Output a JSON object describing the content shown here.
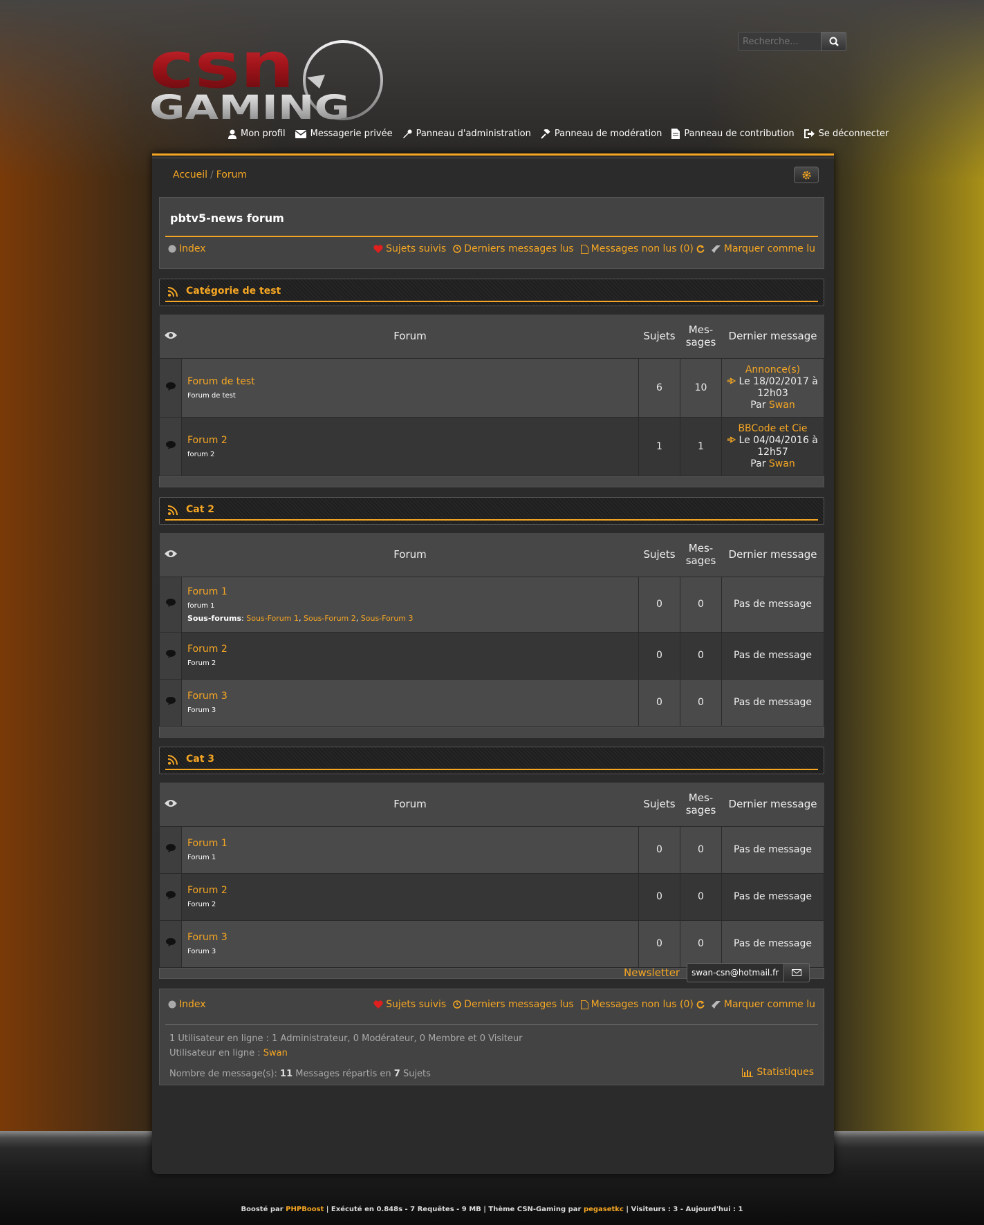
{
  "header": {
    "logo_text_top": "CSN",
    "logo_text_bottom": "GAMING",
    "search_placeholder": "Recherche...",
    "nav": [
      {
        "label": "Mon profil",
        "icon": "user-icon"
      },
      {
        "label": "Messagerie privée",
        "icon": "envelope-icon"
      },
      {
        "label": "Panneau d'administration",
        "icon": "wrench-icon"
      },
      {
        "label": "Panneau de modération",
        "icon": "gavel-icon"
      },
      {
        "label": "Panneau de contribution",
        "icon": "file-icon"
      },
      {
        "label": "Se déconnecter",
        "icon": "sign-out-icon"
      }
    ]
  },
  "breadcrumb": {
    "home": "Accueil",
    "current": "Forum"
  },
  "forum": {
    "title": "pbtv5-news forum",
    "index_label": "Index",
    "links": {
      "followed": "Sujets suivis",
      "last_read": "Derniers messages lus",
      "unread": "Messages non lus (0)",
      "mark_read": "Marquer comme lu"
    }
  },
  "table_headers": {
    "forum": "Forum",
    "topics": "Sujets",
    "messages_line1": "Mes-",
    "messages_line2": "sages",
    "last": "Dernier message"
  },
  "categories": [
    {
      "name": "Catégorie de test",
      "forums": [
        {
          "name": "Forum de test",
          "desc": "Forum de test",
          "topics": "6",
          "messages": "10",
          "last_topic": "Annonce(s)",
          "last_date_line1": "Le 18/02/2017 à",
          "last_date_line2": "12h03",
          "last_by": "Par",
          "last_user": "Swan"
        },
        {
          "name": "Forum 2",
          "desc": "forum 2",
          "topics": "1",
          "messages": "1",
          "last_topic": "BBCode et Cie",
          "last_date_line1": "Le 04/04/2016 à",
          "last_date_line2": "12h57",
          "last_by": "Par",
          "last_user": "Swan"
        }
      ]
    },
    {
      "name": "Cat 2",
      "forums": [
        {
          "name": "Forum 1",
          "desc": "forum 1",
          "topics": "0",
          "messages": "0",
          "no_msg": "Pas de message",
          "subforums_label": "Sous-forums",
          "subforums": [
            "Sous-Forum 1",
            "Sous-Forum 2",
            "Sous-Forum 3"
          ]
        },
        {
          "name": "Forum 2",
          "desc": "Forum 2",
          "topics": "0",
          "messages": "0",
          "no_msg": "Pas de message"
        },
        {
          "name": "Forum 3",
          "desc": "Forum 3",
          "topics": "0",
          "messages": "0",
          "no_msg": "Pas de message"
        }
      ]
    },
    {
      "name": "Cat 3",
      "forums": [
        {
          "name": "Forum 1",
          "desc": "Forum 1",
          "topics": "0",
          "messages": "0",
          "no_msg": "Pas de message"
        },
        {
          "name": "Forum 2",
          "desc": "Forum 2",
          "topics": "0",
          "messages": "0",
          "no_msg": "Pas de message"
        },
        {
          "name": "Forum 3",
          "desc": "Forum 3",
          "topics": "0",
          "messages": "0",
          "no_msg": "Pas de message"
        }
      ]
    }
  ],
  "footer_box": {
    "online_line": "1 Utilisateur en ligne : 1 Administrateur, 0 Modérateur, 0 Membre et 0 Visiteur",
    "online_users_label": "Utilisateur en ligne :",
    "online_user": "Swan",
    "count_prefix": "Nombre de message(s):",
    "count_messages": "11",
    "count_middle": "Messages répartis en",
    "count_topics": "7",
    "count_suffix": "Sujets",
    "stats_label": "Statistiques"
  },
  "newsletter": {
    "label": "Newsletter",
    "value": "swan-csn@hotmail.fr"
  },
  "credits": {
    "boosted_by": "Boosté par",
    "phpboost": "PHPBoost",
    "exec": "| Exécuté en 0.848s - 7 Requêtes - 9 MB | Thème CSN-Gaming par",
    "author": "pegasetkc",
    "visitors": "| Visiteurs : 3 - Aujourd'hui : 1"
  },
  "colors": {
    "accent": "#f5a623",
    "panel": "#2b2b2b",
    "row_light": "#4a4a4a",
    "row_dark": "#363636"
  }
}
